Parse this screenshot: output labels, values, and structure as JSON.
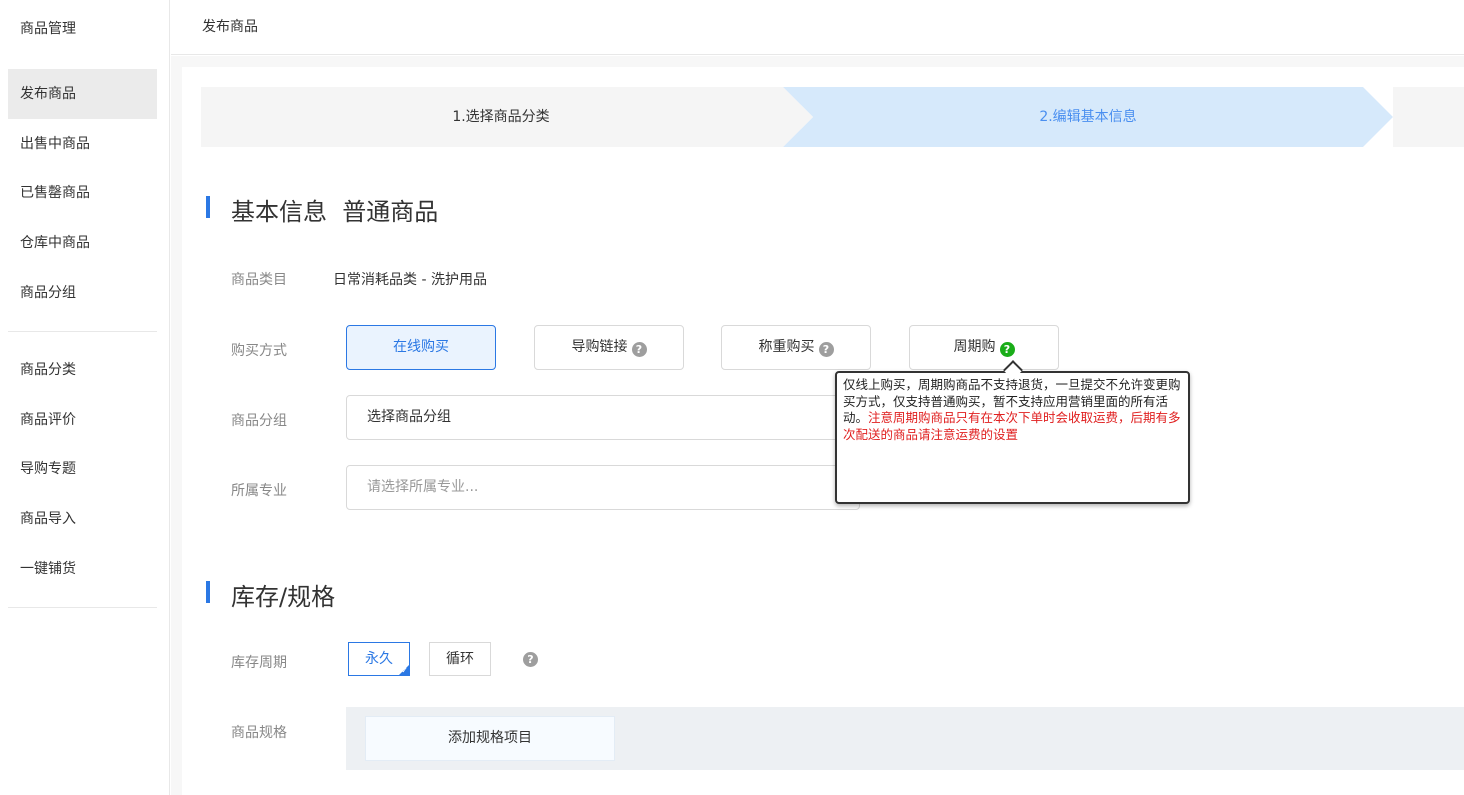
{
  "sidebar": {
    "title": "商品管理",
    "items": [
      {
        "label": "发布商品",
        "active": true
      },
      {
        "label": "出售中商品"
      },
      {
        "label": "已售罄商品"
      },
      {
        "label": "仓库中商品"
      },
      {
        "label": "商品分组"
      },
      {
        "label": "商品分类"
      },
      {
        "label": "商品评价"
      },
      {
        "label": "导购专题"
      },
      {
        "label": "商品导入"
      },
      {
        "label": "一键铺货"
      }
    ]
  },
  "header": {
    "title": "发布商品"
  },
  "steps": [
    {
      "label": "1.选择商品分类"
    },
    {
      "label": "2.编辑基本信息"
    }
  ],
  "basic_info": {
    "title": "基本信息  普通商品",
    "category_label": "商品类目",
    "category_value": "日常消耗品类 - 洗护用品",
    "purchase_label": "购买方式",
    "purchase_options": [
      "在线购买",
      "导购链接",
      "称重购买",
      "周期购"
    ],
    "group_label": "商品分组",
    "group_value": "选择商品分组",
    "major_label": "所属专业",
    "major_placeholder": "请选择所属专业..."
  },
  "tooltip": {
    "normal": "仅线上购买，周期购商品不支持退货，一旦提交不允许变更购买方式，仅支持普通购买，暂不支持应用营销里面的所有活动。",
    "warning": "注意周期购商品只有在本次下单时会收取运费，后期有多次配送的商品请注意运费的设置"
  },
  "stock": {
    "title": "库存/规格",
    "cycle_label": "库存周期",
    "cycle_options": [
      "永久",
      "循环"
    ],
    "spec_label": "商品规格",
    "add_spec_label": "添加规格项目"
  },
  "colors": {
    "accent": "#2b78e4",
    "warning": "#e02020",
    "help_green": "#1aad19"
  }
}
